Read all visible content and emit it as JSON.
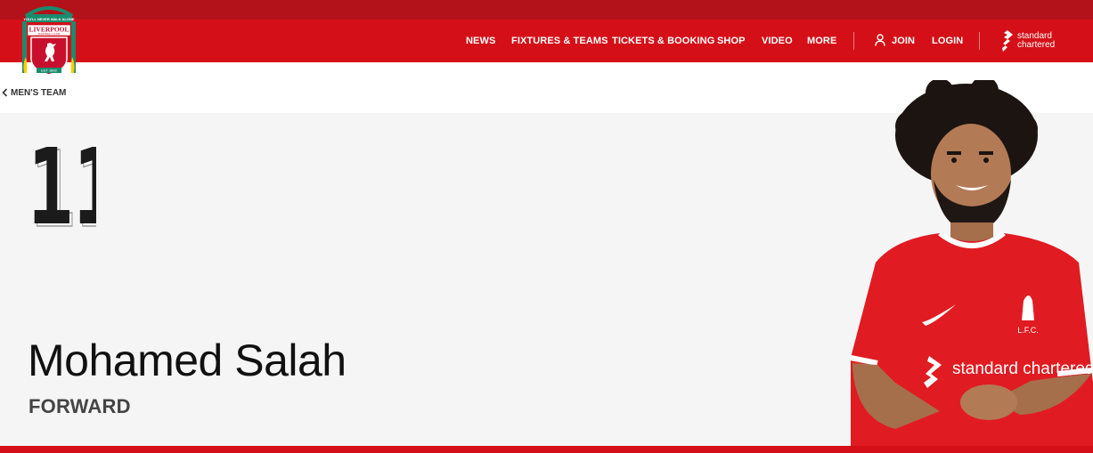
{
  "header": {
    "crest_alt": "Liverpool Football Club crest",
    "crest_text": {
      "top": "YOU'LL NEVER WALK ALONE",
      "club": "LIVERPOOL",
      "sub": "FOOTBALL CLUB",
      "est": "EST 1892"
    },
    "nav": {
      "news": "NEWS",
      "fixtures": "FIXTURES & TEAMS",
      "tickets": "TICKETS & BOOKING",
      "shop": "SHOP",
      "video": "VIDEO",
      "more": "MORE",
      "join": "JOIN",
      "login": "LOGIN"
    },
    "sponsor": {
      "line1": "standard",
      "line2": "chartered"
    }
  },
  "breadcrumb": {
    "label": "MEN'S TEAM"
  },
  "player": {
    "number": "11",
    "name": "Mohamed Salah",
    "position": "FORWARD",
    "shirt_sponsor": "standard chartered",
    "shirt_badge": "L.F.C."
  },
  "colors": {
    "brand_red": "#d50f17",
    "dark_red": "#b3121a",
    "hero_bg": "#f5f5f5",
    "text_dark": "#111111"
  },
  "icons": {
    "back": "chevron-left-icon",
    "user": "user-icon",
    "sponsor": "standard-chartered-logo-icon"
  }
}
